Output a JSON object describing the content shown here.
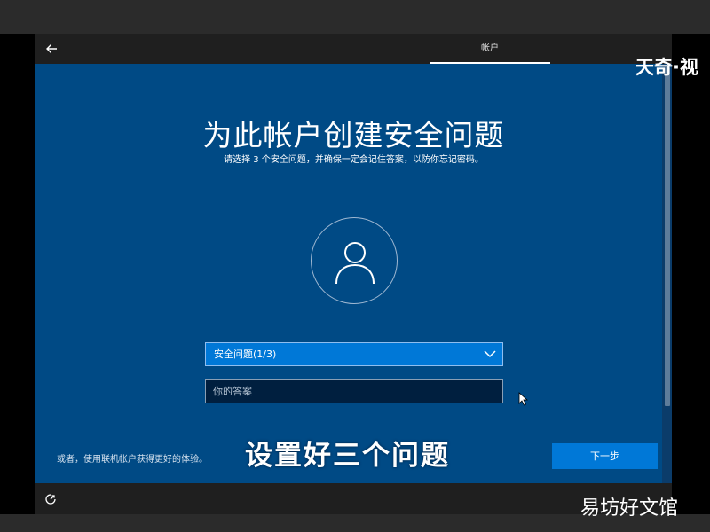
{
  "header": {
    "tab_label": "帐户"
  },
  "title": "为此帐户创建安全问题",
  "subtitle": "请选择 3 个安全问题，并确保一定会记住答案，以防你忘记密码。",
  "question_select": {
    "label": "安全问题(1/3)"
  },
  "answer_input": {
    "placeholder": "你的答案",
    "value": ""
  },
  "footer": {
    "alt_link": "或者，使用联机帐户获得更好的体验。",
    "next_label": "下一步"
  },
  "caption": "设置好三个问题",
  "watermarks": {
    "top": "天奇·视",
    "bottom": "易坊好文馆"
  },
  "colors": {
    "background": "#004a85",
    "accent": "#0078d7",
    "header": "#1f1f1f"
  },
  "icons": [
    "back-arrow-icon",
    "user-icon",
    "chevron-down-icon",
    "mouse-cursor-icon",
    "ease-of-access-icon"
  ]
}
